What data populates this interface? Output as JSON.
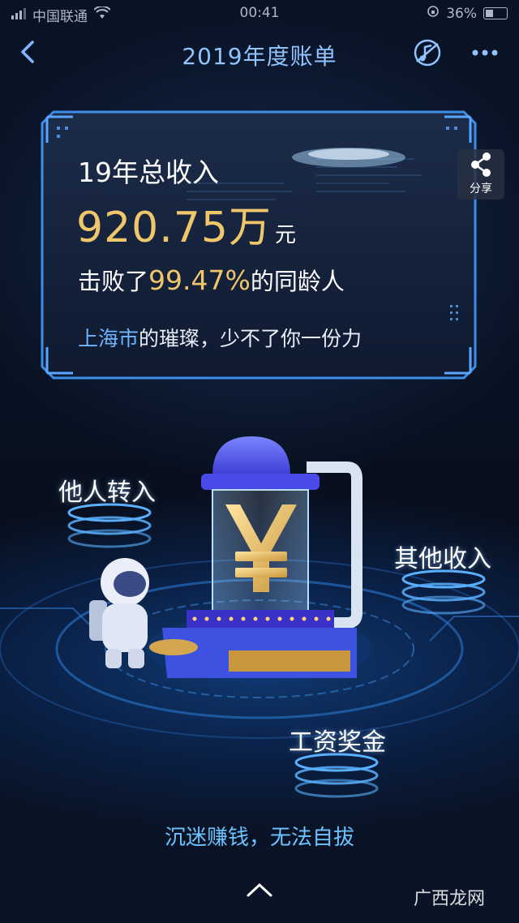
{
  "status_bar": {
    "carrier": "中国联通",
    "time": "00:41",
    "battery": "36%"
  },
  "nav": {
    "title": "2019年度账单",
    "back_icon": "chevron-left-icon",
    "music_icon": "music-note-icon",
    "more_icon": "more-dots-icon"
  },
  "card": {
    "income_title": "19年总收入",
    "income_amount": "920.75万",
    "income_unit": "元",
    "beat_prefix": "击败了",
    "beat_percent": "99.47%",
    "beat_suffix": "的同龄人",
    "city": "上海市",
    "city_suffix": "的璀璨，少不了你一份力"
  },
  "share": {
    "label": "分享",
    "icon": "share-icon"
  },
  "sources": {
    "transfer_in": "他人转入",
    "other_income": "其他收入",
    "salary_bonus": "工资奖金"
  },
  "tagline": "沉迷赚钱，无法自拔",
  "watermark": "广西龙网",
  "colors": {
    "accent_blue": "#6fb4ff",
    "gold": "#f0c66a",
    "frame": "#3c8ee8"
  }
}
